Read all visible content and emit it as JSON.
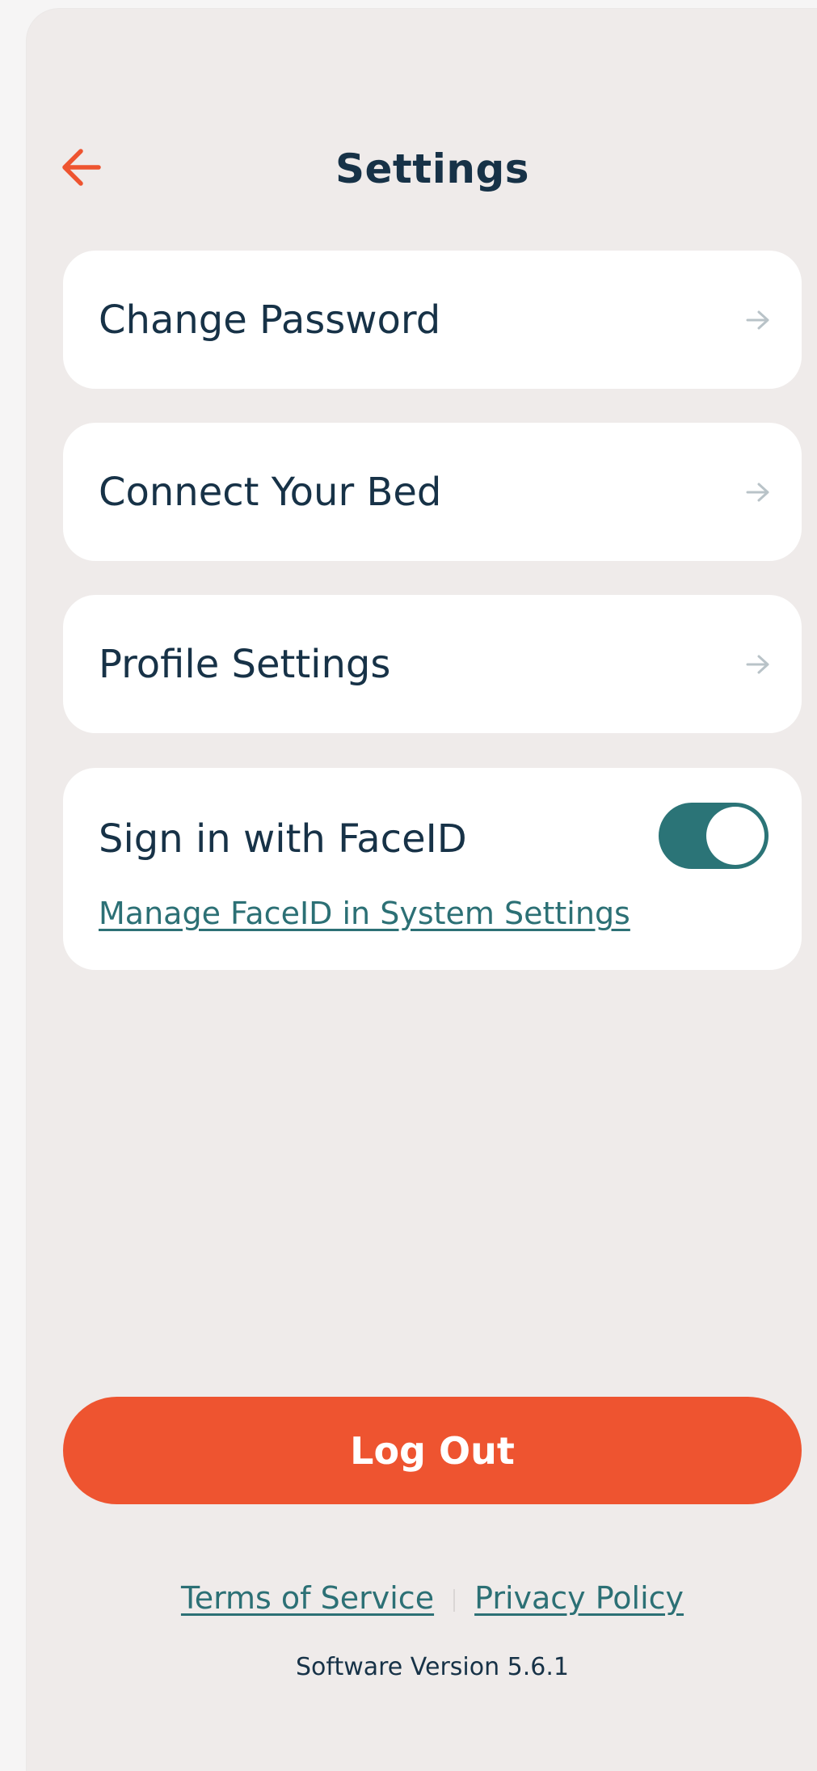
{
  "header": {
    "title": "Settings",
    "back_icon": "arrow-left-icon"
  },
  "settings": {
    "items": [
      {
        "label": "Change Password",
        "icon": "arrow-right-icon"
      },
      {
        "label": "Connect Your Bed",
        "icon": "arrow-right-icon"
      },
      {
        "label": "Profile Settings",
        "icon": "arrow-right-icon"
      }
    ],
    "faceid": {
      "label": "Sign in with FaceID",
      "enabled": true,
      "link": "Manage FaceID in System Settings"
    }
  },
  "actions": {
    "logout_label": "Log Out"
  },
  "footer": {
    "terms": "Terms of Service",
    "privacy": "Privacy Policy",
    "version": "Software Version 5.6.1"
  },
  "colors": {
    "background": "#efebea",
    "card": "#ffffff",
    "text_primary": "#173247",
    "accent_orange": "#ee5430",
    "accent_teal": "#2b7477",
    "chevron": "#b9c3c8"
  }
}
